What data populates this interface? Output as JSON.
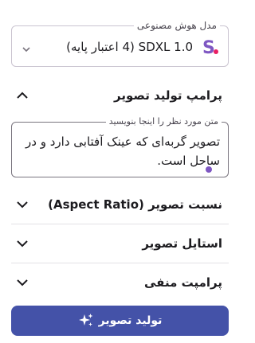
{
  "model_selector": {
    "label": "مدل هوش مصنوعی",
    "value": "SDXL 1.0 (4 اعتبار پایه)",
    "logo_colors": [
      "#7e57c2",
      "#e91e63"
    ]
  },
  "sections": {
    "prompt": {
      "label": "پرامپ تولید تصویر",
      "expanded": true
    },
    "aspect_ratio": {
      "label": "نسبت تصویر (Aspect Ratio)",
      "expanded": false
    },
    "style": {
      "label": "استایل تصویر",
      "expanded": false
    },
    "negative_prompt": {
      "label": "پرامپت منفی",
      "expanded": false
    }
  },
  "prompt_field": {
    "label": "متن مورد نظر را اینجا بنویسید",
    "value": "تصویر گربه‌ای که عینک آفتابی دارد و در ساحل است."
  },
  "generate_button": {
    "label": "تولید تصویر",
    "icon": "sparkles-icon"
  },
  "colors": {
    "primary": "#4452a8",
    "accent": "#7e57c2"
  }
}
